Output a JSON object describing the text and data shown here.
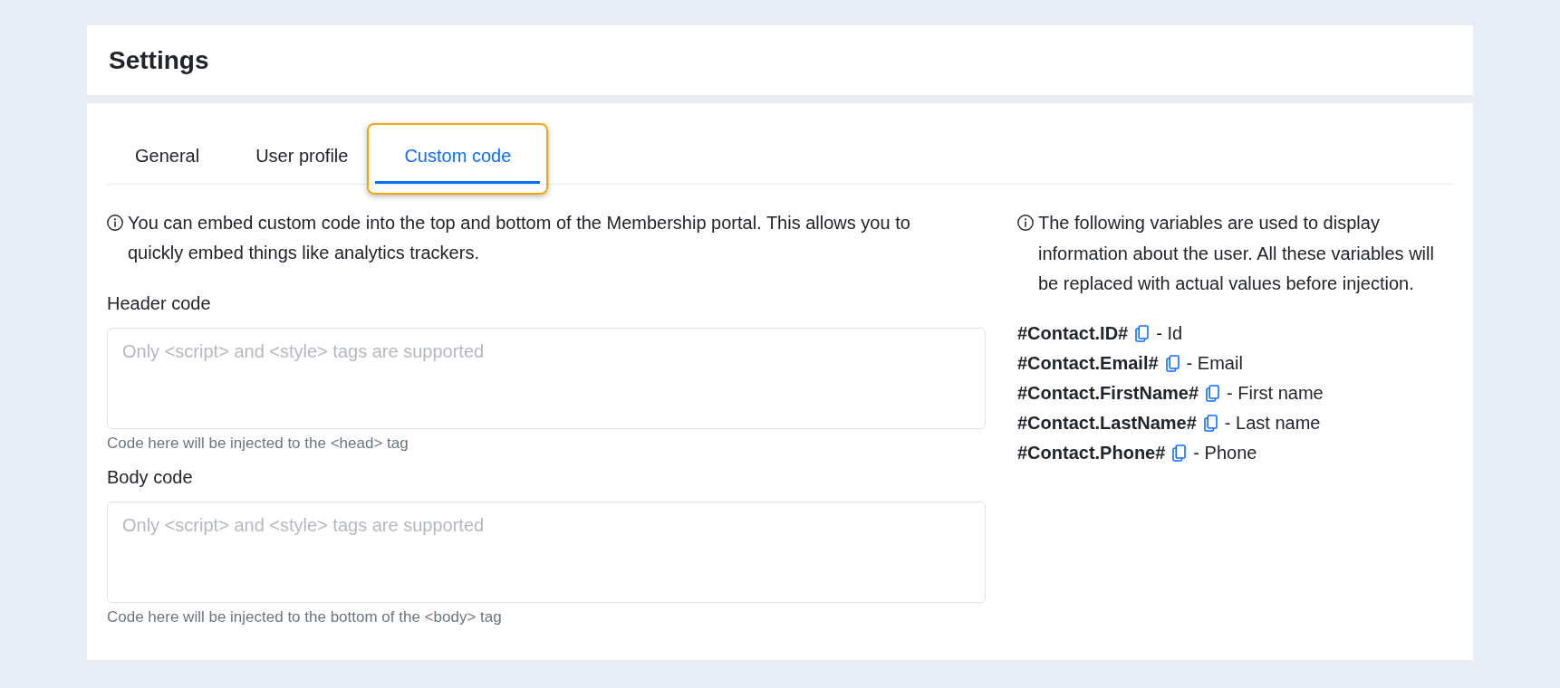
{
  "header": {
    "title": "Settings"
  },
  "tabs": [
    {
      "label": "General",
      "selected": false,
      "focused": false
    },
    {
      "label": "User profile",
      "selected": false,
      "focused": false
    },
    {
      "label": "Custom code",
      "selected": true,
      "focused": true
    }
  ],
  "custom_code": {
    "info": "You can embed custom code into the top and bottom of the Membership portal. This allows you to quickly embed things like analytics trackers.",
    "fields": [
      {
        "label": "Header code",
        "placeholder": "Only <script> and <style> tags are supported",
        "hint": "Code here will be injected to the <head> tag"
      },
      {
        "label": "Body code",
        "placeholder": "Only <script> and <style> tags are supported",
        "hint": "Code here will be injected to the bottom of the <body> tag"
      }
    ]
  },
  "variables": {
    "info": "The following variables are used to display information about the user. All these variables will be replaced with actual values before injection.",
    "items": [
      {
        "token": "#Contact.ID#",
        "description": "- Id"
      },
      {
        "token": "#Contact.Email#",
        "description": "- Email"
      },
      {
        "token": "#Contact.FirstName#",
        "description": "- First name"
      },
      {
        "token": "#Contact.LastName#",
        "description": "- Last name"
      },
      {
        "token": "#Contact.Phone#",
        "description": "- Phone"
      }
    ]
  }
}
